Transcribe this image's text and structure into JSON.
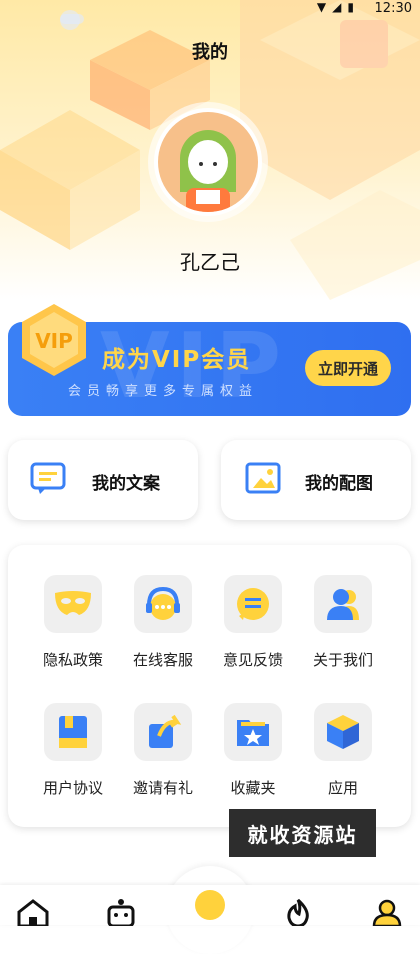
{
  "status_bar": {
    "time": "12:30"
  },
  "header": {
    "title": "我的"
  },
  "profile": {
    "username": "孔乙己"
  },
  "vip": {
    "badge_text": "VIP",
    "title": "成为VIP会员",
    "subtitle": "会员畅享更多专属权益",
    "cta_label": "立即开通",
    "watermark": "VIP"
  },
  "quick_actions": [
    {
      "label": "我的文案",
      "icon": "message-icon"
    },
    {
      "label": "我的配图",
      "icon": "image-icon"
    }
  ],
  "menu": {
    "items": [
      {
        "label": "隐私政策",
        "icon": "mask-icon"
      },
      {
        "label": "在线客服",
        "icon": "headset-icon"
      },
      {
        "label": "意见反馈",
        "icon": "chat-bubble-icon"
      },
      {
        "label": "关于我们",
        "icon": "users-icon"
      },
      {
        "label": "用户协议",
        "icon": "book-icon"
      },
      {
        "label": "邀请有礼",
        "icon": "share-icon"
      },
      {
        "label": "收藏夹",
        "icon": "folder-star-icon"
      },
      {
        "label": "应用",
        "icon": "cube-icon"
      }
    ]
  },
  "overlay_watermark": "就收资源站",
  "tabbar": {
    "items": [
      {
        "icon": "home-icon"
      },
      {
        "icon": "robot-icon"
      },
      {
        "icon": "center-action-icon"
      },
      {
        "icon": "flame-icon"
      },
      {
        "icon": "profile-icon",
        "active": true
      }
    ]
  },
  "colors": {
    "brand_blue": "#3a80f5",
    "accent_yellow": "#ffd54a",
    "tile_gray": "#efefef"
  }
}
